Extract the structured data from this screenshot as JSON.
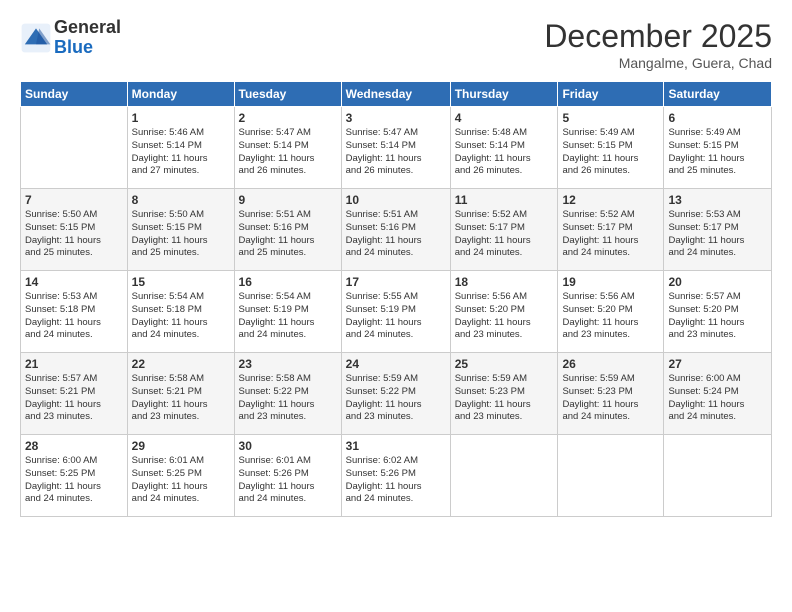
{
  "logo": {
    "text_general": "General",
    "text_blue": "Blue"
  },
  "header": {
    "month_year": "December 2025",
    "location": "Mangalme, Guera, Chad"
  },
  "weekdays": [
    "Sunday",
    "Monday",
    "Tuesday",
    "Wednesday",
    "Thursday",
    "Friday",
    "Saturday"
  ],
  "weeks": [
    [
      {
        "day": "",
        "info": ""
      },
      {
        "day": "1",
        "info": "Sunrise: 5:46 AM\nSunset: 5:14 PM\nDaylight: 11 hours\nand 27 minutes."
      },
      {
        "day": "2",
        "info": "Sunrise: 5:47 AM\nSunset: 5:14 PM\nDaylight: 11 hours\nand 26 minutes."
      },
      {
        "day": "3",
        "info": "Sunrise: 5:47 AM\nSunset: 5:14 PM\nDaylight: 11 hours\nand 26 minutes."
      },
      {
        "day": "4",
        "info": "Sunrise: 5:48 AM\nSunset: 5:14 PM\nDaylight: 11 hours\nand 26 minutes."
      },
      {
        "day": "5",
        "info": "Sunrise: 5:49 AM\nSunset: 5:15 PM\nDaylight: 11 hours\nand 26 minutes."
      },
      {
        "day": "6",
        "info": "Sunrise: 5:49 AM\nSunset: 5:15 PM\nDaylight: 11 hours\nand 25 minutes."
      }
    ],
    [
      {
        "day": "7",
        "info": "Sunrise: 5:50 AM\nSunset: 5:15 PM\nDaylight: 11 hours\nand 25 minutes."
      },
      {
        "day": "8",
        "info": "Sunrise: 5:50 AM\nSunset: 5:15 PM\nDaylight: 11 hours\nand 25 minutes."
      },
      {
        "day": "9",
        "info": "Sunrise: 5:51 AM\nSunset: 5:16 PM\nDaylight: 11 hours\nand 25 minutes."
      },
      {
        "day": "10",
        "info": "Sunrise: 5:51 AM\nSunset: 5:16 PM\nDaylight: 11 hours\nand 24 minutes."
      },
      {
        "day": "11",
        "info": "Sunrise: 5:52 AM\nSunset: 5:17 PM\nDaylight: 11 hours\nand 24 minutes."
      },
      {
        "day": "12",
        "info": "Sunrise: 5:52 AM\nSunset: 5:17 PM\nDaylight: 11 hours\nand 24 minutes."
      },
      {
        "day": "13",
        "info": "Sunrise: 5:53 AM\nSunset: 5:17 PM\nDaylight: 11 hours\nand 24 minutes."
      }
    ],
    [
      {
        "day": "14",
        "info": "Sunrise: 5:53 AM\nSunset: 5:18 PM\nDaylight: 11 hours\nand 24 minutes."
      },
      {
        "day": "15",
        "info": "Sunrise: 5:54 AM\nSunset: 5:18 PM\nDaylight: 11 hours\nand 24 minutes."
      },
      {
        "day": "16",
        "info": "Sunrise: 5:54 AM\nSunset: 5:19 PM\nDaylight: 11 hours\nand 24 minutes."
      },
      {
        "day": "17",
        "info": "Sunrise: 5:55 AM\nSunset: 5:19 PM\nDaylight: 11 hours\nand 24 minutes."
      },
      {
        "day": "18",
        "info": "Sunrise: 5:56 AM\nSunset: 5:20 PM\nDaylight: 11 hours\nand 23 minutes."
      },
      {
        "day": "19",
        "info": "Sunrise: 5:56 AM\nSunset: 5:20 PM\nDaylight: 11 hours\nand 23 minutes."
      },
      {
        "day": "20",
        "info": "Sunrise: 5:57 AM\nSunset: 5:20 PM\nDaylight: 11 hours\nand 23 minutes."
      }
    ],
    [
      {
        "day": "21",
        "info": "Sunrise: 5:57 AM\nSunset: 5:21 PM\nDaylight: 11 hours\nand 23 minutes."
      },
      {
        "day": "22",
        "info": "Sunrise: 5:58 AM\nSunset: 5:21 PM\nDaylight: 11 hours\nand 23 minutes."
      },
      {
        "day": "23",
        "info": "Sunrise: 5:58 AM\nSunset: 5:22 PM\nDaylight: 11 hours\nand 23 minutes."
      },
      {
        "day": "24",
        "info": "Sunrise: 5:59 AM\nSunset: 5:22 PM\nDaylight: 11 hours\nand 23 minutes."
      },
      {
        "day": "25",
        "info": "Sunrise: 5:59 AM\nSunset: 5:23 PM\nDaylight: 11 hours\nand 23 minutes."
      },
      {
        "day": "26",
        "info": "Sunrise: 5:59 AM\nSunset: 5:23 PM\nDaylight: 11 hours\nand 24 minutes."
      },
      {
        "day": "27",
        "info": "Sunrise: 6:00 AM\nSunset: 5:24 PM\nDaylight: 11 hours\nand 24 minutes."
      }
    ],
    [
      {
        "day": "28",
        "info": "Sunrise: 6:00 AM\nSunset: 5:25 PM\nDaylight: 11 hours\nand 24 minutes."
      },
      {
        "day": "29",
        "info": "Sunrise: 6:01 AM\nSunset: 5:25 PM\nDaylight: 11 hours\nand 24 minutes."
      },
      {
        "day": "30",
        "info": "Sunrise: 6:01 AM\nSunset: 5:26 PM\nDaylight: 11 hours\nand 24 minutes."
      },
      {
        "day": "31",
        "info": "Sunrise: 6:02 AM\nSunset: 5:26 PM\nDaylight: 11 hours\nand 24 minutes."
      },
      {
        "day": "",
        "info": ""
      },
      {
        "day": "",
        "info": ""
      },
      {
        "day": "",
        "info": ""
      }
    ]
  ]
}
